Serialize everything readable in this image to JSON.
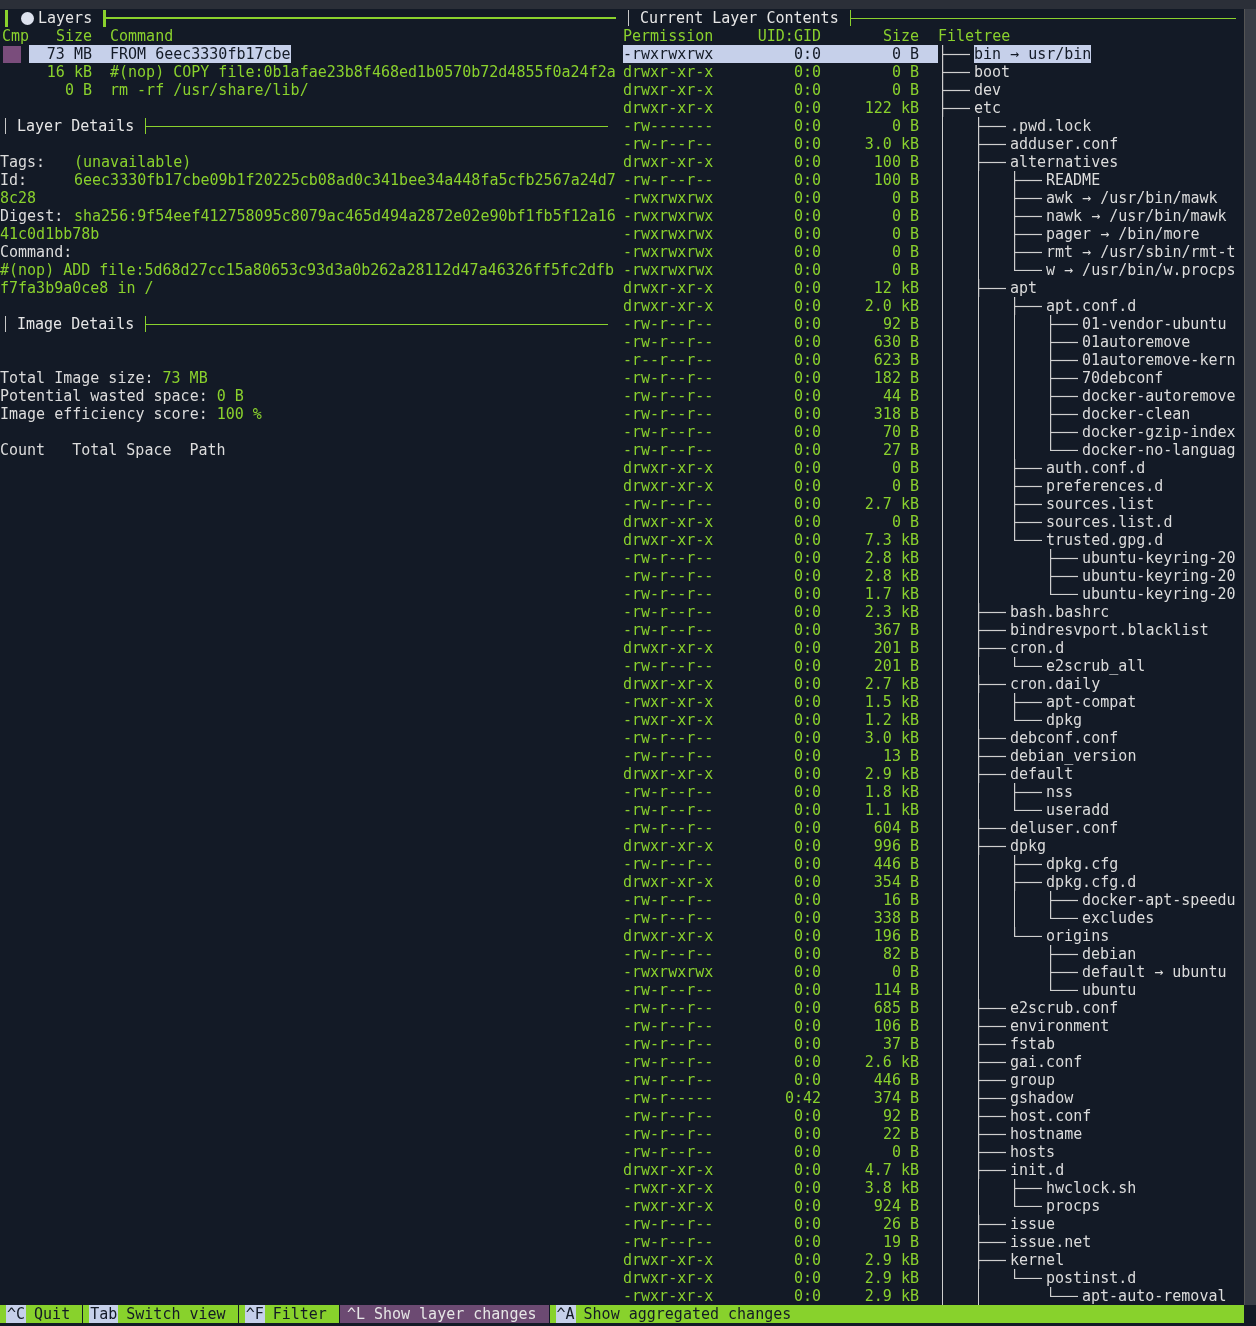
{
  "layers_panel": {
    "title": "Layers",
    "focused": true,
    "columns": [
      "Cmp",
      "Size",
      "Command"
    ],
    "rows": [
      {
        "size": "73 MB",
        "command": "FROM 6eec3330fb17cbe",
        "compared": true,
        "selected": true
      },
      {
        "size": "16 kB",
        "command": "#(nop) COPY file:0b1afae23b8f468ed1b0570b72d4855f0a24f2a",
        "compared": false,
        "selected": false
      },
      {
        "size": "0 B",
        "command": "rm -rf /usr/share/lib/",
        "compared": false,
        "selected": false
      }
    ]
  },
  "layer_details": {
    "title": "Layer Details",
    "fields": [
      {
        "label": "Tags:",
        "value": "(unavailable)"
      },
      {
        "label": "Id:",
        "value": "6eec3330fb17cbe09b1f20225cb08ad0c341bee34a448fa5cfb2567a24d78c28"
      },
      {
        "label": "Digest:",
        "value": "sha256:9f54eef412758095c8079ac465d494a2872e02e90bf1fb5f12a1641c0d1bb78b"
      }
    ],
    "command_label": "Command:",
    "command": "#(nop) ADD file:5d68d27cc15a80653c93d3a0b262a28112d47a46326ff5fc2dfbf7fa3b9a0ce8 in /"
  },
  "image_details": {
    "title": "Image Details",
    "stats": [
      {
        "label": "Total Image size:",
        "value": "73 MB"
      },
      {
        "label": "Potential wasted space:",
        "value": "0 B"
      },
      {
        "label": "Image efficiency score:",
        "value": "100 %"
      }
    ],
    "columns": [
      "Count",
      "Total Space",
      "Path"
    ]
  },
  "contents_panel": {
    "title": "Current Layer Contents",
    "focused": false,
    "columns": [
      "Permission",
      "UID:GID",
      "Size",
      "Filetree"
    ],
    "tree": [
      {
        "permission": "-rwxrwxrwx",
        "uid_gid": "0:0",
        "size": "0 B",
        "name": "bin → usr/bin",
        "last": false,
        "selected": true
      },
      {
        "permission": "drwxr-xr-x",
        "uid_gid": "0:0",
        "size": "0 B",
        "name": "boot",
        "last": false,
        "selected": false
      },
      {
        "permission": "drwxr-xr-x",
        "uid_gid": "0:0",
        "size": "0 B",
        "name": "dev",
        "last": false,
        "selected": false
      },
      {
        "permission": "drwxr-xr-x",
        "uid_gid": "0:0",
        "size": "122 kB",
        "name": "etc",
        "last": false,
        "selected": false,
        "children": [
          {
            "permission": "-rw-------",
            "uid_gid": "0:0",
            "size": "0 B",
            "name": ".pwd.lock",
            "last": false,
            "selected": false
          },
          {
            "permission": "-rw-r--r--",
            "uid_gid": "0:0",
            "size": "3.0 kB",
            "name": "adduser.conf",
            "last": false,
            "selected": false
          },
          {
            "permission": "drwxr-xr-x",
            "uid_gid": "0:0",
            "size": "100 B",
            "name": "alternatives",
            "last": false,
            "selected": false,
            "children": [
              {
                "permission": "-rw-r--r--",
                "uid_gid": "0:0",
                "size": "100 B",
                "name": "README",
                "last": false,
                "selected": false
              },
              {
                "permission": "-rwxrwxrwx",
                "uid_gid": "0:0",
                "size": "0 B",
                "name": "awk → /usr/bin/mawk",
                "last": false,
                "selected": false
              },
              {
                "permission": "-rwxrwxrwx",
                "uid_gid": "0:0",
                "size": "0 B",
                "name": "nawk → /usr/bin/mawk",
                "last": false,
                "selected": false
              },
              {
                "permission": "-rwxrwxrwx",
                "uid_gid": "0:0",
                "size": "0 B",
                "name": "pager → /bin/more",
                "last": false,
                "selected": false
              },
              {
                "permission": "-rwxrwxrwx",
                "uid_gid": "0:0",
                "size": "0 B",
                "name": "rmt → /usr/sbin/rmt-t",
                "last": false,
                "selected": false
              },
              {
                "permission": "-rwxrwxrwx",
                "uid_gid": "0:0",
                "size": "0 B",
                "name": "w → /usr/bin/w.procps",
                "last": true,
                "selected": false
              }
            ]
          },
          {
            "permission": "drwxr-xr-x",
            "uid_gid": "0:0",
            "size": "12 kB",
            "name": "apt",
            "last": false,
            "selected": false,
            "children": [
              {
                "permission": "drwxr-xr-x",
                "uid_gid": "0:0",
                "size": "2.0 kB",
                "name": "apt.conf.d",
                "last": false,
                "selected": false,
                "children": [
                  {
                    "permission": "-rw-r--r--",
                    "uid_gid": "0:0",
                    "size": "92 B",
                    "name": "01-vendor-ubuntu",
                    "last": false,
                    "selected": false
                  },
                  {
                    "permission": "-rw-r--r--",
                    "uid_gid": "0:0",
                    "size": "630 B",
                    "name": "01autoremove",
                    "last": false,
                    "selected": false
                  },
                  {
                    "permission": "-r--r--r--",
                    "uid_gid": "0:0",
                    "size": "623 B",
                    "name": "01autoremove-kern",
                    "last": false,
                    "selected": false
                  },
                  {
                    "permission": "-rw-r--r--",
                    "uid_gid": "0:0",
                    "size": "182 B",
                    "name": "70debconf",
                    "last": false,
                    "selected": false
                  },
                  {
                    "permission": "-rw-r--r--",
                    "uid_gid": "0:0",
                    "size": "44 B",
                    "name": "docker-autoremove",
                    "last": false,
                    "selected": false
                  },
                  {
                    "permission": "-rw-r--r--",
                    "uid_gid": "0:0",
                    "size": "318 B",
                    "name": "docker-clean",
                    "last": false,
                    "selected": false
                  },
                  {
                    "permission": "-rw-r--r--",
                    "uid_gid": "0:0",
                    "size": "70 B",
                    "name": "docker-gzip-index",
                    "last": false,
                    "selected": false
                  },
                  {
                    "permission": "-rw-r--r--",
                    "uid_gid": "0:0",
                    "size": "27 B",
                    "name": "docker-no-languag",
                    "last": true,
                    "selected": false
                  }
                ]
              },
              {
                "permission": "drwxr-xr-x",
                "uid_gid": "0:0",
                "size": "0 B",
                "name": "auth.conf.d",
                "last": false,
                "selected": false
              },
              {
                "permission": "drwxr-xr-x",
                "uid_gid": "0:0",
                "size": "0 B",
                "name": "preferences.d",
                "last": false,
                "selected": false
              },
              {
                "permission": "-rw-r--r--",
                "uid_gid": "0:0",
                "size": "2.7 kB",
                "name": "sources.list",
                "last": false,
                "selected": false
              },
              {
                "permission": "drwxr-xr-x",
                "uid_gid": "0:0",
                "size": "0 B",
                "name": "sources.list.d",
                "last": false,
                "selected": false
              },
              {
                "permission": "drwxr-xr-x",
                "uid_gid": "0:0",
                "size": "7.3 kB",
                "name": "trusted.gpg.d",
                "last": true,
                "selected": false,
                "children": [
                  {
                    "permission": "-rw-r--r--",
                    "uid_gid": "0:0",
                    "size": "2.8 kB",
                    "name": "ubuntu-keyring-20",
                    "last": false,
                    "selected": false
                  },
                  {
                    "permission": "-rw-r--r--",
                    "uid_gid": "0:0",
                    "size": "2.8 kB",
                    "name": "ubuntu-keyring-20",
                    "last": false,
                    "selected": false
                  },
                  {
                    "permission": "-rw-r--r--",
                    "uid_gid": "0:0",
                    "size": "1.7 kB",
                    "name": "ubuntu-keyring-20",
                    "last": true,
                    "selected": false
                  }
                ]
              }
            ]
          },
          {
            "permission": "-rw-r--r--",
            "uid_gid": "0:0",
            "size": "2.3 kB",
            "name": "bash.bashrc",
            "last": false,
            "selected": false
          },
          {
            "permission": "-rw-r--r--",
            "uid_gid": "0:0",
            "size": "367 B",
            "name": "bindresvport.blacklist",
            "last": false,
            "selected": false
          },
          {
            "permission": "drwxr-xr-x",
            "uid_gid": "0:0",
            "size": "201 B",
            "name": "cron.d",
            "last": false,
            "selected": false,
            "children": [
              {
                "permission": "-rw-r--r--",
                "uid_gid": "0:0",
                "size": "201 B",
                "name": "e2scrub_all",
                "last": true,
                "selected": false
              }
            ]
          },
          {
            "permission": "drwxr-xr-x",
            "uid_gid": "0:0",
            "size": "2.7 kB",
            "name": "cron.daily",
            "last": false,
            "selected": false,
            "children": [
              {
                "permission": "-rwxr-xr-x",
                "uid_gid": "0:0",
                "size": "1.5 kB",
                "name": "apt-compat",
                "last": false,
                "selected": false
              },
              {
                "permission": "-rwxr-xr-x",
                "uid_gid": "0:0",
                "size": "1.2 kB",
                "name": "dpkg",
                "last": true,
                "selected": false
              }
            ]
          },
          {
            "permission": "-rw-r--r--",
            "uid_gid": "0:0",
            "size": "3.0 kB",
            "name": "debconf.conf",
            "last": false,
            "selected": false
          },
          {
            "permission": "-rw-r--r--",
            "uid_gid": "0:0",
            "size": "13 B",
            "name": "debian_version",
            "last": false,
            "selected": false
          },
          {
            "permission": "drwxr-xr-x",
            "uid_gid": "0:0",
            "size": "2.9 kB",
            "name": "default",
            "last": false,
            "selected": false,
            "children": [
              {
                "permission": "-rw-r--r--",
                "uid_gid": "0:0",
                "size": "1.8 kB",
                "name": "nss",
                "last": false,
                "selected": false
              },
              {
                "permission": "-rw-r--r--",
                "uid_gid": "0:0",
                "size": "1.1 kB",
                "name": "useradd",
                "last": true,
                "selected": false
              }
            ]
          },
          {
            "permission": "-rw-r--r--",
            "uid_gid": "0:0",
            "size": "604 B",
            "name": "deluser.conf",
            "last": false,
            "selected": false
          },
          {
            "permission": "drwxr-xr-x",
            "uid_gid": "0:0",
            "size": "996 B",
            "name": "dpkg",
            "last": false,
            "selected": false,
            "children": [
              {
                "permission": "-rw-r--r--",
                "uid_gid": "0:0",
                "size": "446 B",
                "name": "dpkg.cfg",
                "last": false,
                "selected": false
              },
              {
                "permission": "drwxr-xr-x",
                "uid_gid": "0:0",
                "size": "354 B",
                "name": "dpkg.cfg.d",
                "last": false,
                "selected": false,
                "children": [
                  {
                    "permission": "-rw-r--r--",
                    "uid_gid": "0:0",
                    "size": "16 B",
                    "name": "docker-apt-speedu",
                    "last": false,
                    "selected": false
                  },
                  {
                    "permission": "-rw-r--r--",
                    "uid_gid": "0:0",
                    "size": "338 B",
                    "name": "excludes",
                    "last": true,
                    "selected": false
                  }
                ]
              },
              {
                "permission": "drwxr-xr-x",
                "uid_gid": "0:0",
                "size": "196 B",
                "name": "origins",
                "last": true,
                "selected": false,
                "children": [
                  {
                    "permission": "-rw-r--r--",
                    "uid_gid": "0:0",
                    "size": "82 B",
                    "name": "debian",
                    "last": false,
                    "selected": false
                  },
                  {
                    "permission": "-rwxrwxrwx",
                    "uid_gid": "0:0",
                    "size": "0 B",
                    "name": "default → ubuntu",
                    "last": false,
                    "selected": false
                  },
                  {
                    "permission": "-rw-r--r--",
                    "uid_gid": "0:0",
                    "size": "114 B",
                    "name": "ubuntu",
                    "last": true,
                    "selected": false
                  }
                ]
              }
            ]
          },
          {
            "permission": "-rw-r--r--",
            "uid_gid": "0:0",
            "size": "685 B",
            "name": "e2scrub.conf",
            "last": false,
            "selected": false
          },
          {
            "permission": "-rw-r--r--",
            "uid_gid": "0:0",
            "size": "106 B",
            "name": "environment",
            "last": false,
            "selected": false
          },
          {
            "permission": "-rw-r--r--",
            "uid_gid": "0:0",
            "size": "37 B",
            "name": "fstab",
            "last": false,
            "selected": false
          },
          {
            "permission": "-rw-r--r--",
            "uid_gid": "0:0",
            "size": "2.6 kB",
            "name": "gai.conf",
            "last": false,
            "selected": false
          },
          {
            "permission": "-rw-r--r--",
            "uid_gid": "0:0",
            "size": "446 B",
            "name": "group",
            "last": false,
            "selected": false
          },
          {
            "permission": "-rw-r-----",
            "uid_gid": "0:42",
            "size": "374 B",
            "name": "gshadow",
            "last": false,
            "selected": false
          },
          {
            "permission": "-rw-r--r--",
            "uid_gid": "0:0",
            "size": "92 B",
            "name": "host.conf",
            "last": false,
            "selected": false
          },
          {
            "permission": "-rw-r--r--",
            "uid_gid": "0:0",
            "size": "22 B",
            "name": "hostname",
            "last": false,
            "selected": false
          },
          {
            "permission": "-rw-r--r--",
            "uid_gid": "0:0",
            "size": "0 B",
            "name": "hosts",
            "last": false,
            "selected": false
          },
          {
            "permission": "drwxr-xr-x",
            "uid_gid": "0:0",
            "size": "4.7 kB",
            "name": "init.d",
            "last": false,
            "selected": false,
            "children": [
              {
                "permission": "-rwxr-xr-x",
                "uid_gid": "0:0",
                "size": "3.8 kB",
                "name": "hwclock.sh",
                "last": false,
                "selected": false
              },
              {
                "permission": "-rwxr-xr-x",
                "uid_gid": "0:0",
                "size": "924 B",
                "name": "procps",
                "last": true,
                "selected": false
              }
            ]
          },
          {
            "permission": "-rw-r--r--",
            "uid_gid": "0:0",
            "size": "26 B",
            "name": "issue",
            "last": false,
            "selected": false
          },
          {
            "permission": "-rw-r--r--",
            "uid_gid": "0:0",
            "size": "19 B",
            "name": "issue.net",
            "last": false,
            "selected": false
          },
          {
            "permission": "drwxr-xr-x",
            "uid_gid": "0:0",
            "size": "2.9 kB",
            "name": "kernel",
            "last": false,
            "selected": false,
            "children": [
              {
                "permission": "drwxr-xr-x",
                "uid_gid": "0:0",
                "size": "2.9 kB",
                "name": "postinst.d",
                "last": true,
                "selected": false,
                "children": [
                  {
                    "permission": "-rwxr-xr-x",
                    "uid_gid": "0:0",
                    "size": "2.9 kB",
                    "name": "apt-auto-removal",
                    "last": true,
                    "selected": false
                  }
                ]
              }
            ]
          }
        ]
      }
    ]
  },
  "key_bar": [
    {
      "key": "^C",
      "label": "Quit",
      "selected": false
    },
    {
      "key": "Tab",
      "label": "Switch view",
      "selected": false
    },
    {
      "key": "^F",
      "label": "Filter",
      "selected": false
    },
    {
      "key": "^L",
      "label": "Show layer changes",
      "selected": true
    },
    {
      "key": "^A",
      "label": "Show aggregated changes",
      "selected": false
    }
  ]
}
